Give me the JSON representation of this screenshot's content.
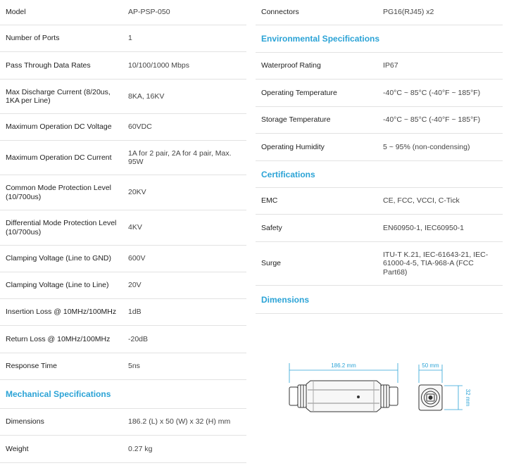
{
  "left": {
    "rows": [
      {
        "label": "Model",
        "value": "AP-PSP-050"
      },
      {
        "label": "Number of Ports",
        "value": "1"
      },
      {
        "label": "Pass Through Data Rates",
        "value": "10/100/1000 Mbps"
      },
      {
        "label": "Max Discharge Current (8/20us, 1KA per Line)",
        "value": "8KA, 16KV"
      },
      {
        "label": "Maximum Operation DC Voltage",
        "value": "60VDC"
      },
      {
        "label": "Maximum Operation DC Current",
        "value": "1A for 2 pair, 2A for 4 pair, Max. 95W"
      },
      {
        "label": "Common Mode Protection Level (10/700us)",
        "value": "20KV"
      },
      {
        "label": "Differential Mode Protection Level (10/700us)",
        "value": "4KV"
      },
      {
        "label": "Clamping Voltage (Line to GND)",
        "value": "600V"
      },
      {
        "label": "Clamping Voltage (Line to Line)",
        "value": "20V"
      },
      {
        "label": "Insertion Loss @ 10MHz/100MHz",
        "value": "1dB"
      },
      {
        "label": "Return Loss @ 10MHz/100MHz",
        "value": "-20dB"
      },
      {
        "label": "Response Time",
        "value": "5ns"
      }
    ],
    "mechanical_heading": "Mechanical Specifications",
    "mechanical_rows": [
      {
        "label": "Dimensions",
        "value": "186.2 (L) x 50 (W) x 32 (H) mm"
      },
      {
        "label": "Weight",
        "value": "0.27 kg"
      }
    ]
  },
  "right": {
    "connectors": {
      "label": "Connectors",
      "value": "PG16(RJ45) x2"
    },
    "environmental_heading": "Environmental Specifications",
    "environmental_rows": [
      {
        "label": "Waterproof Rating",
        "value": "IP67"
      },
      {
        "label": "Operating Temperature",
        "value": "-40°C ~ 85°C (-40°F ~ 185°F)"
      },
      {
        "label": "Storage Temperature",
        "value": "-40°C ~ 85°C (-40°F ~ 185°F)"
      },
      {
        "label": "Operating Humidity",
        "value": "5 ~ 95% (non-condensing)"
      }
    ],
    "certifications_heading": "Certifications",
    "certifications_rows": [
      {
        "label": "EMC",
        "value": "CE, FCC, VCCI, C-Tick"
      },
      {
        "label": "Safety",
        "value": "EN60950-1, IEC60950-1"
      },
      {
        "label": "Surge",
        "value": "ITU-T K.21, IEC-61643-21, IEC-61000-4-5, TIA-968-A (FCC Part68)"
      }
    ],
    "dimensions_heading": "Dimensions",
    "drawing": {
      "length_label": "186.2 mm",
      "width_label": "50 mm",
      "height_label": "32 mm",
      "line_color": "#2ba3d6"
    }
  }
}
